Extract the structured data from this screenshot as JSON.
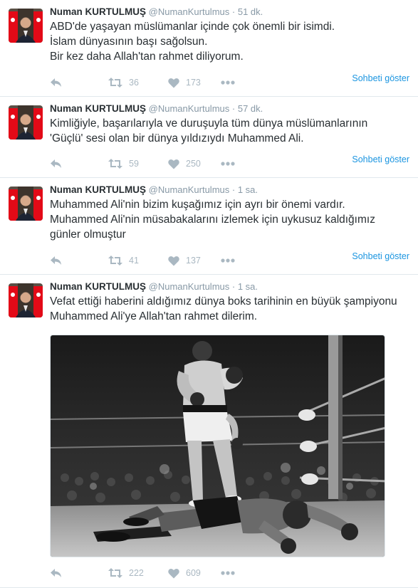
{
  "tweets": [
    {
      "name": "Numan KURTULMUŞ",
      "handle": "@NumanKurtulmus",
      "separator": "·",
      "time": "51 dk.",
      "lines": [
        "ABD'de yaşayan müslümanlar içinde çok önemli bir isimdi.",
        "İslam dünyasının başı sağolsun.",
        "Bir kez daha Allah'tan rahmet diliyorum."
      ],
      "retweets": "36",
      "likes": "173",
      "conversation": "Sohbeti göster"
    },
    {
      "name": "Numan KURTULMUŞ",
      "handle": "@NumanKurtulmus",
      "separator": "·",
      "time": "57 dk.",
      "lines": [
        "Kimliğiyle, başarılarıyla ve duruşuyla tüm dünya müslümanlarının",
        "'Güçlü' sesi olan bir dünya yıldızıydı Muhammed Ali."
      ],
      "retweets": "59",
      "likes": "250",
      "conversation": "Sohbeti göster"
    },
    {
      "name": "Numan KURTULMUŞ",
      "handle": "@NumanKurtulmus",
      "separator": "·",
      "time": "1 sa.",
      "lines": [
        "Muhammed Ali'nin bizim kuşağımız için ayrı bir önemi vardır.",
        "Muhammed Ali'nin müsabakalarını izlemek için uykusuz kaldığımız",
        "günler olmuştur"
      ],
      "retweets": "41",
      "likes": "137",
      "conversation": "Sohbeti göster"
    },
    {
      "name": "Numan KURTULMUŞ",
      "handle": "@NumanKurtulmus",
      "separator": "·",
      "time": "1 sa.",
      "lines": [
        "Vefat ettiği haberini aldığımız dünya boks tarihinin en büyük şampiyonu",
        "Muhammed Ali'ye Allah'tan rahmet dilerim."
      ],
      "retweets": "222",
      "likes": "609"
    }
  ],
  "colors": {
    "name": "#292f33",
    "meta": "#8899a6",
    "action_icon": "#aab8c2",
    "link": "#1b95e0",
    "divider": "#e1e8ed",
    "flag_red": "#e30a17"
  },
  "icons": [
    "reply-icon",
    "retweet-icon",
    "like-icon",
    "more-icon"
  ]
}
